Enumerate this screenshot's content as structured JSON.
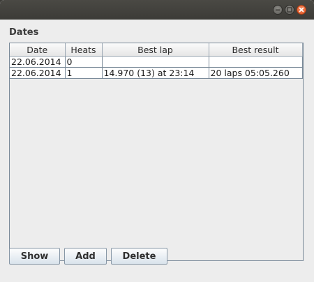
{
  "window": {
    "controls": [
      "minimize-icon",
      "maximize-icon",
      "close-icon"
    ]
  },
  "section": {
    "label": "Dates"
  },
  "table": {
    "headers": [
      "Date",
      "Heats",
      "Best lap",
      "Best result"
    ],
    "rows": [
      [
        "22.06.2014",
        "0",
        "",
        ""
      ],
      [
        "22.06.2014",
        "1",
        "14.970 (13) at 23:14",
        "20 laps 05:05.260"
      ]
    ]
  },
  "buttons": {
    "show": "Show",
    "add": "Add",
    "delete": "Delete"
  },
  "colors": {
    "close_button": "#e0521f",
    "titlebar": "#3c3b37",
    "background": "#ededed"
  }
}
